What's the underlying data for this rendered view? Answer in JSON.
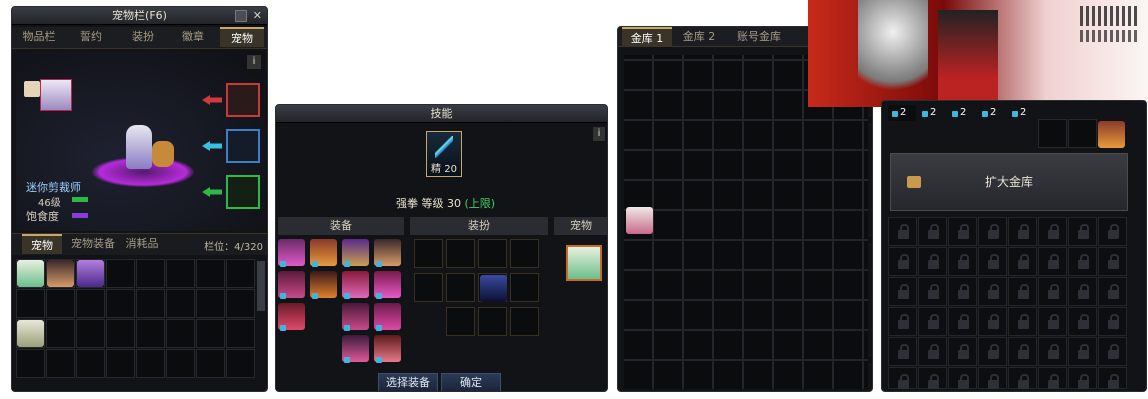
{
  "pet_window": {
    "title": "宠物栏(F6)",
    "tabs": [
      "物品栏",
      "誓约",
      "装扮",
      "徽章",
      "宠物"
    ],
    "pet_name": "迷你剪裁师",
    "level": "46级",
    "satiety_label": "饱食度",
    "info": "i",
    "inv_tabs": [
      "宠物",
      "宠物装备",
      "消耗品"
    ],
    "capacity": "栏位：4/320"
  },
  "skill_window": {
    "title": "技能",
    "skill_badge": "精 20",
    "skill_line": "强拳 等级 30",
    "skill_limit": "(上限)",
    "info": "i",
    "col_equip": "装备",
    "col_avatar": "装扮",
    "col_pet": "宠物",
    "select_button": "选择装备",
    "confirm_button": "确定"
  },
  "bank_window": {
    "tabs": [
      "金库 1",
      "金库 2",
      "账号金库"
    ]
  },
  "account_bank": {
    "expand_button": "扩大金库",
    "small_counts": [
      "2",
      "2",
      "2",
      "2",
      "2"
    ]
  },
  "colors": {
    "accent": "#c8a86a",
    "green": "#2fb84a",
    "purple": "#8a3cd8",
    "red": "#c83a3a",
    "blue": "#3b7fc8"
  }
}
